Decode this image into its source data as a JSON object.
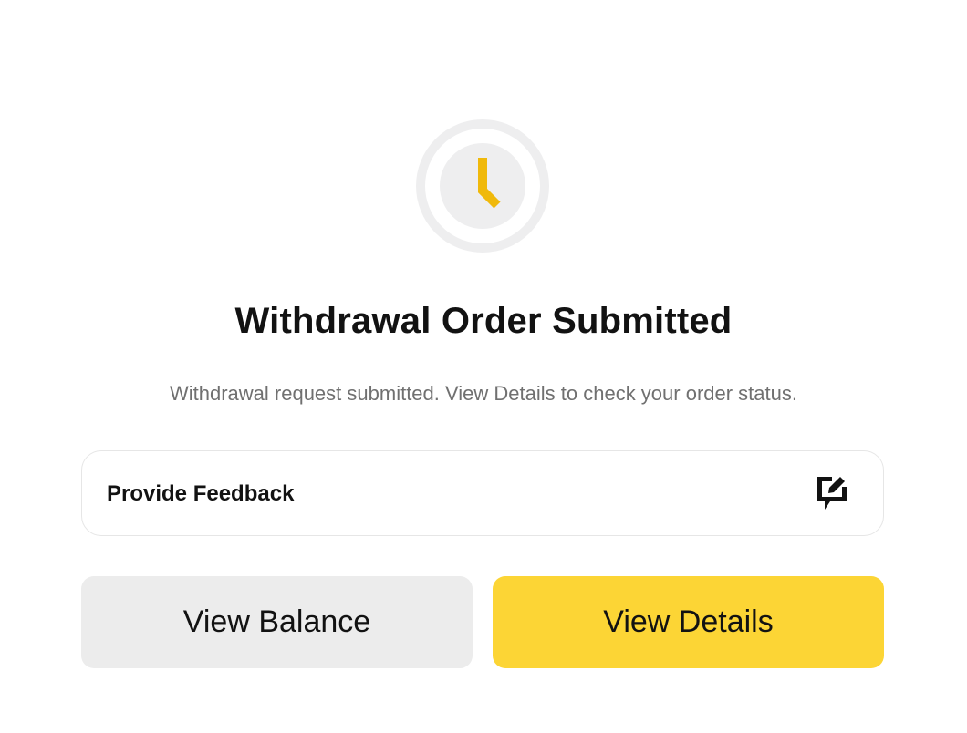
{
  "status": {
    "icon": "clock-icon",
    "accent_color": "#f0b90b",
    "ring_color": "#eeeeef"
  },
  "title": "Withdrawal Order Submitted",
  "subtitle": "Withdrawal request submitted. View Details to check your order status.",
  "feedback": {
    "label": "Provide Feedback",
    "icon": "feedback-edit-icon"
  },
  "actions": {
    "secondary_label": "View Balance",
    "primary_label": "View Details",
    "primary_color": "#fcd535",
    "secondary_color": "#ececec"
  }
}
